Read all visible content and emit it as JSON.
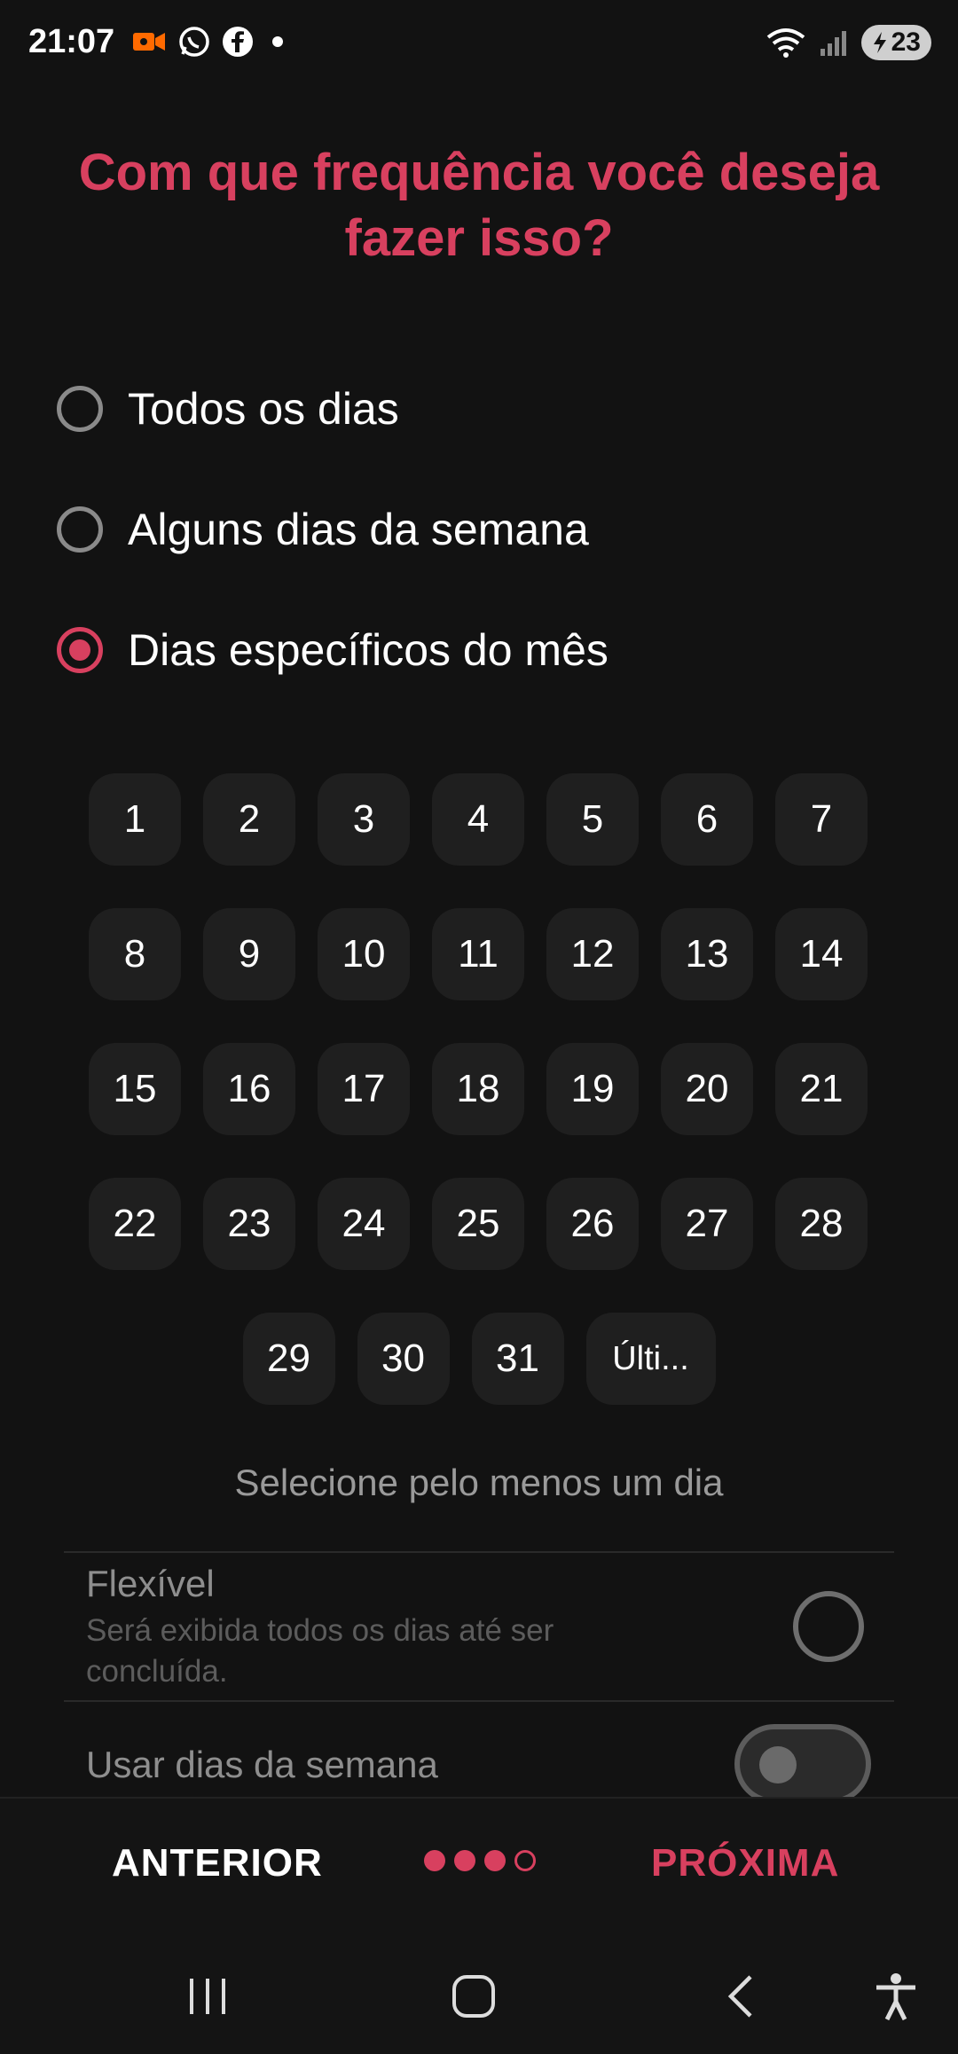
{
  "status_bar": {
    "time": "21:07",
    "icons": [
      "video-record-icon",
      "whatsapp-icon",
      "facebook-icon",
      "dot-icon"
    ],
    "right_icons": [
      "wifi-icon",
      "signal-icon"
    ],
    "battery": "23",
    "accent": "#ff6a00"
  },
  "title": "Com que frequência você deseja fazer isso?",
  "options": [
    {
      "label": "Todos os dias",
      "checked": false
    },
    {
      "label": "Alguns dias da semana",
      "checked": false
    },
    {
      "label": "Dias específicos do mês",
      "checked": true
    }
  ],
  "days": {
    "row1": [
      "1",
      "2",
      "3",
      "4",
      "5",
      "6",
      "7"
    ],
    "row2": [
      "8",
      "9",
      "10",
      "11",
      "12",
      "13",
      "14"
    ],
    "row3": [
      "15",
      "16",
      "17",
      "18",
      "19",
      "20",
      "21"
    ],
    "row4": [
      "22",
      "23",
      "24",
      "25",
      "26",
      "27",
      "28"
    ],
    "row5": [
      "29",
      "30",
      "31",
      "Últi..."
    ]
  },
  "hint": "Selecione pelo menos um dia",
  "flexible": {
    "title": "Flexível",
    "description": "Será exibida todos os dias até ser concluída.",
    "checked": false
  },
  "weekdays": {
    "label": "Usar dias da semana",
    "enabled": false
  },
  "footer": {
    "prev_label": "ANTERIOR",
    "next_label": "PRÓXIMA",
    "steps_total": 4,
    "steps_done": 3
  },
  "nav": [
    "recents-icon",
    "home-icon",
    "back-icon",
    "accessibility-icon"
  ],
  "colors": {
    "accent": "#d8405f",
    "background": "#121212"
  }
}
